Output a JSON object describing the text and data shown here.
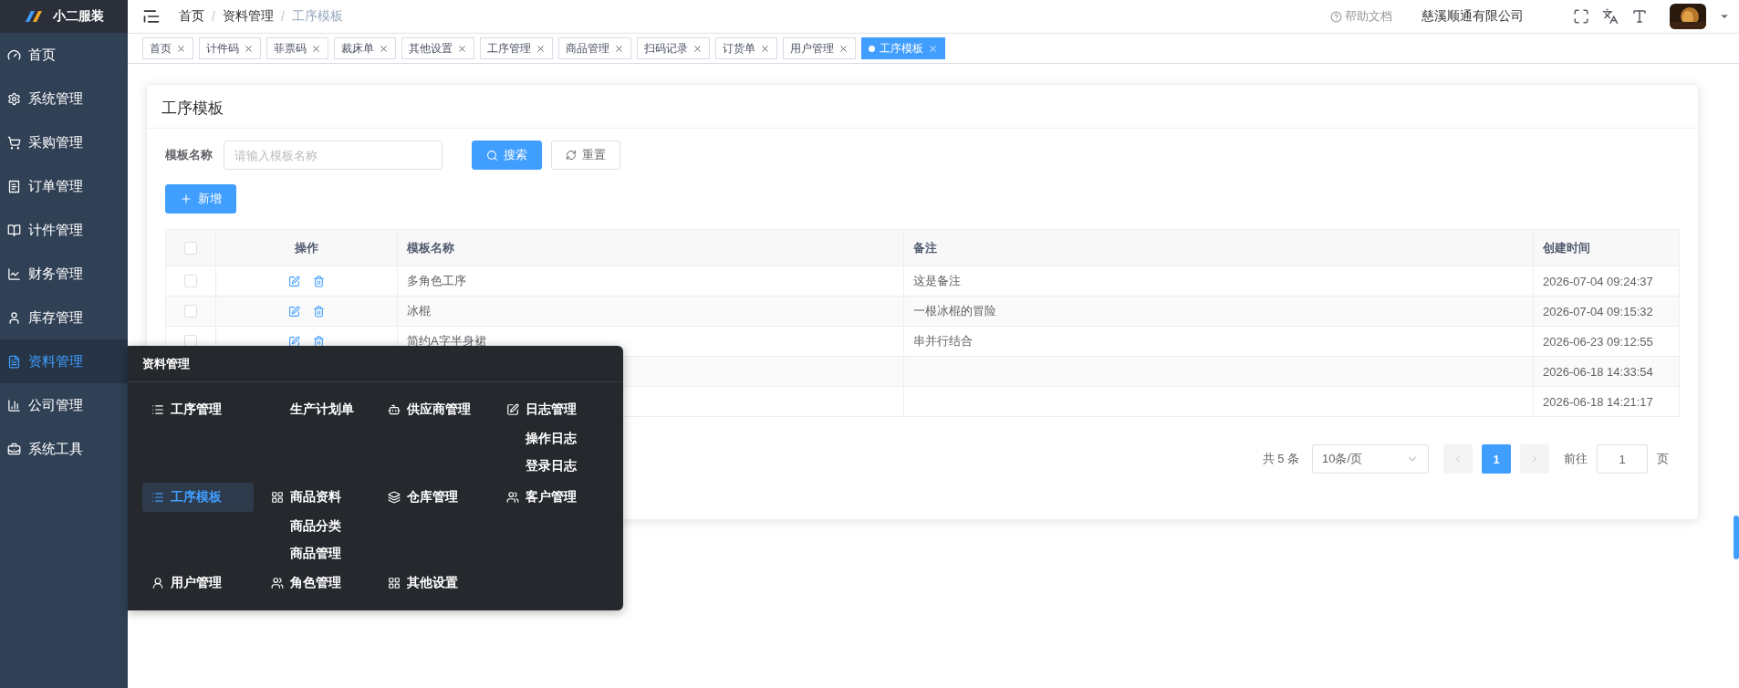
{
  "brand": {
    "name": "小二服装"
  },
  "sidebar": {
    "items": [
      {
        "label": "首页",
        "selected": false
      },
      {
        "label": "系统管理",
        "selected": false
      },
      {
        "label": "采购管理",
        "selected": false
      },
      {
        "label": "订单管理",
        "selected": false
      },
      {
        "label": "计件管理",
        "selected": false
      },
      {
        "label": "财务管理",
        "selected": false
      },
      {
        "label": "库存管理",
        "selected": false
      },
      {
        "label": "资料管理",
        "selected": true
      },
      {
        "label": "公司管理",
        "selected": false
      },
      {
        "label": "系统工具",
        "selected": false
      }
    ]
  },
  "breadcrumb": [
    {
      "label": "首页"
    },
    {
      "separator": "/",
      "label": "资料管理"
    },
    {
      "separator": "/",
      "label": "工序模板"
    }
  ],
  "header": {
    "help": "帮助文档",
    "company": "慈溪顺通有限公司"
  },
  "tabs": [
    {
      "label": "首页",
      "selected": false
    },
    {
      "label": "计件码",
      "selected": false
    },
    {
      "label": "菲票码",
      "selected": false
    },
    {
      "label": "裁床单",
      "selected": false
    },
    {
      "label": "其他设置",
      "selected": false
    },
    {
      "label": "工序管理",
      "selected": false
    },
    {
      "label": "商品管理",
      "selected": false
    },
    {
      "label": "扫码记录",
      "selected": false
    },
    {
      "label": "订货单",
      "selected": false
    },
    {
      "label": "用户管理",
      "selected": false
    },
    {
      "label": "工序模板",
      "selected": true
    }
  ],
  "card": {
    "title": "工序模板"
  },
  "search": {
    "label": "模板名称",
    "placeholder": "请输入模板名称",
    "search_button": "搜索",
    "reset_button": "重置",
    "add_button": "新增"
  },
  "table": {
    "all_checked": false,
    "columns": [
      "操作",
      "模板名称",
      "备注",
      "创建时间"
    ],
    "rows": [
      {
        "checked": false,
        "name": "多角色工序",
        "note": "这是备注",
        "created": "2026-07-04 09:24:37"
      },
      {
        "checked": false,
        "name": "冰棍",
        "note": "一根冰棍的冒险",
        "created": "2026-07-04 09:15:32"
      },
      {
        "checked": false,
        "name": "简约A字半身裙",
        "note": "串并行结合",
        "created": "2026-06-23 09:12:55"
      },
      {
        "created": "2026-06-18 14:33:54"
      },
      {
        "created": "2026-06-18 14:21:17"
      }
    ]
  },
  "pagination": {
    "total": "共 5 条",
    "page_size": "10条/页",
    "pages": [
      {
        "label": "1",
        "selected": true
      }
    ],
    "goto_label": "前往",
    "goto_value": "1",
    "goto_suffix": "页"
  },
  "flyout": {
    "title": "资料管理",
    "groups": [
      {
        "label": "工序管理",
        "selected": false
      },
      {
        "label": "生产计划单",
        "selected": false
      },
      {
        "label": "供应商管理",
        "selected": false
      },
      {
        "label": "日志管理",
        "selected": false,
        "children": [
          "操作日志",
          "登录日志"
        ]
      },
      {
        "label": "工序模板",
        "selected": true
      },
      {
        "label": "商品资料",
        "selected": false,
        "children": [
          "商品分类",
          "商品管理"
        ]
      },
      {
        "label": "仓库管理",
        "selected": false
      },
      {
        "label": "客户管理",
        "selected": false
      },
      {
        "label": "用户管理",
        "selected": false
      },
      {
        "label": "角色管理",
        "selected": false
      },
      {
        "label": "其他设置",
        "selected": false
      }
    ]
  }
}
